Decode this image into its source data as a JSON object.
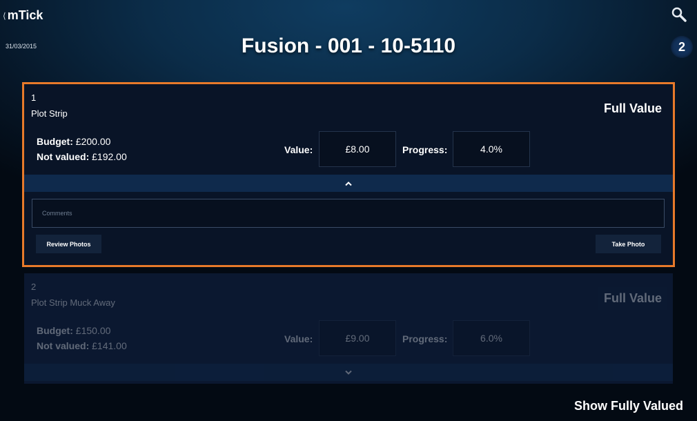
{
  "header": {
    "back_label": "mTick",
    "date": "31/03/2015",
    "title": "Fusion - 001 - 10-5110",
    "badge_count": "2"
  },
  "items": [
    {
      "number": "1",
      "name": "Plot Strip",
      "full_value_label": "Full Value",
      "budget_label": "Budget:",
      "budget_value": "£200.00",
      "not_valued_label": "Not valued:",
      "not_valued_value": "£192.00",
      "value_label": "Value:",
      "value": "£8.00",
      "progress_label": "Progress:",
      "progress": "4.0%",
      "expanded": true,
      "comments_placeholder": "Comments",
      "review_photos_label": "Review Photos",
      "take_photo_label": "Take Photo"
    },
    {
      "number": "2",
      "name": "Plot Strip Muck Away",
      "full_value_label": "Full Value",
      "budget_label": "Budget:",
      "budget_value": "£150.00",
      "not_valued_label": "Not valued:",
      "not_valued_value": "£141.00",
      "value_label": "Value:",
      "value": "£9.00",
      "progress_label": "Progress:",
      "progress": "6.0%",
      "expanded": false
    }
  ],
  "footer": {
    "show_fully_valued_label": "Show Fully Valued"
  },
  "colors": {
    "selection_outline": "#e87a2a",
    "bar": "#0f2a4c"
  },
  "icons": {
    "back": "chevron-left-icon",
    "search": "search-icon",
    "collapse": "chevron-up-icon",
    "expand": "chevron-down-icon"
  }
}
